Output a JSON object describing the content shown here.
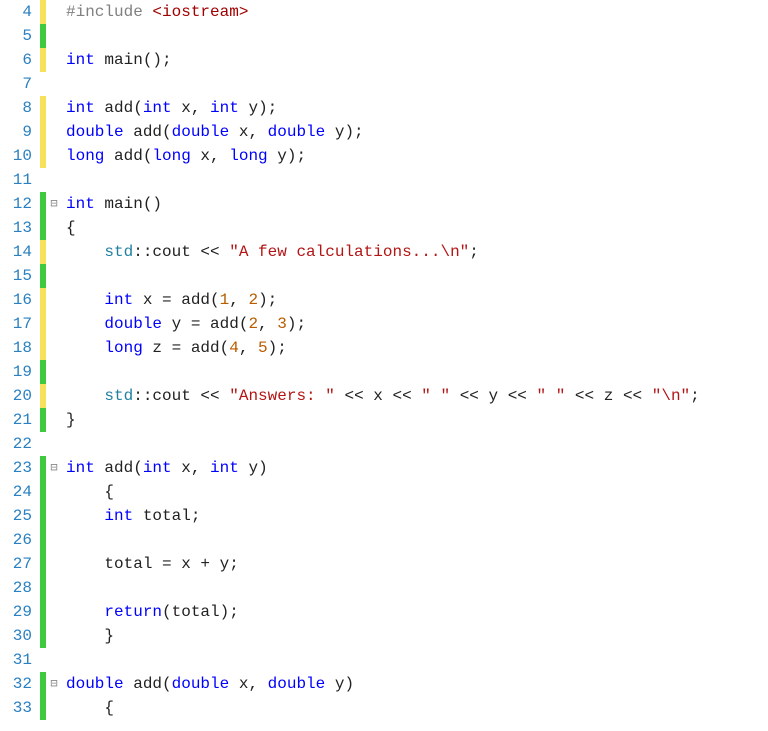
{
  "fold_glyph": "⊟",
  "lines": [
    {
      "n": 4,
      "mark": "m-y",
      "fold": "",
      "code": [
        {
          "c": "prep",
          "t": "#include "
        },
        {
          "c": "inc",
          "t": "<iostream>"
        }
      ]
    },
    {
      "n": 5,
      "mark": "m-g",
      "fold": "",
      "code": []
    },
    {
      "n": 6,
      "mark": "m-y",
      "fold": "",
      "code": [
        {
          "c": "kw",
          "t": "int"
        },
        {
          "c": "",
          "t": " main();"
        }
      ]
    },
    {
      "n": 7,
      "mark": "m-none",
      "fold": "",
      "code": []
    },
    {
      "n": 8,
      "mark": "m-y",
      "fold": "",
      "code": [
        {
          "c": "kw",
          "t": "int"
        },
        {
          "c": "",
          "t": " add("
        },
        {
          "c": "kw",
          "t": "int"
        },
        {
          "c": "",
          "t": " x, "
        },
        {
          "c": "kw",
          "t": "int"
        },
        {
          "c": "",
          "t": " y);"
        }
      ]
    },
    {
      "n": 9,
      "mark": "m-y",
      "fold": "",
      "code": [
        {
          "c": "kw",
          "t": "double"
        },
        {
          "c": "",
          "t": " add("
        },
        {
          "c": "kw",
          "t": "double"
        },
        {
          "c": "",
          "t": " x, "
        },
        {
          "c": "kw",
          "t": "double"
        },
        {
          "c": "",
          "t": " y);"
        }
      ]
    },
    {
      "n": 10,
      "mark": "m-y",
      "fold": "",
      "code": [
        {
          "c": "kw",
          "t": "long"
        },
        {
          "c": "",
          "t": " add("
        },
        {
          "c": "kw",
          "t": "long"
        },
        {
          "c": "",
          "t": " x, "
        },
        {
          "c": "kw",
          "t": "long"
        },
        {
          "c": "",
          "t": " y);"
        }
      ]
    },
    {
      "n": 11,
      "mark": "m-none",
      "fold": "",
      "code": []
    },
    {
      "n": 12,
      "mark": "m-g",
      "fold": "y",
      "code": [
        {
          "c": "kw",
          "t": "int"
        },
        {
          "c": "",
          "t": " main()"
        }
      ]
    },
    {
      "n": 13,
      "mark": "m-g",
      "fold": "",
      "code": [
        {
          "c": "",
          "t": "{"
        }
      ]
    },
    {
      "n": 14,
      "mark": "m-y",
      "fold": "",
      "code": [
        {
          "c": "",
          "t": "    "
        },
        {
          "c": "cls",
          "t": "std"
        },
        {
          "c": "",
          "t": "::cout << "
        },
        {
          "c": "str",
          "t": "\"A few calculations...\\n\""
        },
        {
          "c": "",
          "t": ";"
        }
      ]
    },
    {
      "n": 15,
      "mark": "m-g",
      "fold": "",
      "code": []
    },
    {
      "n": 16,
      "mark": "m-y",
      "fold": "",
      "code": [
        {
          "c": "",
          "t": "    "
        },
        {
          "c": "kw",
          "t": "int"
        },
        {
          "c": "",
          "t": " x = add("
        },
        {
          "c": "num",
          "t": "1"
        },
        {
          "c": "",
          "t": ", "
        },
        {
          "c": "num",
          "t": "2"
        },
        {
          "c": "",
          "t": ");"
        }
      ]
    },
    {
      "n": 17,
      "mark": "m-y",
      "fold": "",
      "code": [
        {
          "c": "",
          "t": "    "
        },
        {
          "c": "kw",
          "t": "double"
        },
        {
          "c": "",
          "t": " y = add("
        },
        {
          "c": "num",
          "t": "2"
        },
        {
          "c": "",
          "t": ", "
        },
        {
          "c": "num",
          "t": "3"
        },
        {
          "c": "",
          "t": ");"
        }
      ]
    },
    {
      "n": 18,
      "mark": "m-y",
      "fold": "",
      "code": [
        {
          "c": "",
          "t": "    "
        },
        {
          "c": "kw",
          "t": "long"
        },
        {
          "c": "",
          "t": " z = add("
        },
        {
          "c": "num",
          "t": "4"
        },
        {
          "c": "",
          "t": ", "
        },
        {
          "c": "num",
          "t": "5"
        },
        {
          "c": "",
          "t": ");"
        }
      ]
    },
    {
      "n": 19,
      "mark": "m-g",
      "fold": "",
      "code": []
    },
    {
      "n": 20,
      "mark": "m-y",
      "fold": "",
      "code": [
        {
          "c": "",
          "t": "    "
        },
        {
          "c": "cls",
          "t": "std"
        },
        {
          "c": "",
          "t": "::cout << "
        },
        {
          "c": "str",
          "t": "\"Answers: \""
        },
        {
          "c": "",
          "t": " << x << "
        },
        {
          "c": "str",
          "t": "\" \""
        },
        {
          "c": "",
          "t": " << y << "
        },
        {
          "c": "str",
          "t": "\" \""
        },
        {
          "c": "",
          "t": " << z << "
        },
        {
          "c": "str",
          "t": "\"\\n\""
        },
        {
          "c": "",
          "t": ";"
        }
      ]
    },
    {
      "n": 21,
      "mark": "m-g",
      "fold": "",
      "code": [
        {
          "c": "",
          "t": "}"
        }
      ]
    },
    {
      "n": 22,
      "mark": "m-none",
      "fold": "",
      "code": []
    },
    {
      "n": 23,
      "mark": "m-g",
      "fold": "y",
      "code": [
        {
          "c": "kw",
          "t": "int"
        },
        {
          "c": "",
          "t": " add("
        },
        {
          "c": "kw",
          "t": "int"
        },
        {
          "c": "",
          "t": " x, "
        },
        {
          "c": "kw",
          "t": "int"
        },
        {
          "c": "",
          "t": " y)"
        }
      ]
    },
    {
      "n": 24,
      "mark": "m-g",
      "fold": "",
      "code": [
        {
          "c": "",
          "t": "    {"
        }
      ]
    },
    {
      "n": 25,
      "mark": "m-g",
      "fold": "",
      "code": [
        {
          "c": "",
          "t": "    "
        },
        {
          "c": "kw",
          "t": "int"
        },
        {
          "c": "",
          "t": " total;"
        }
      ]
    },
    {
      "n": 26,
      "mark": "m-g",
      "fold": "",
      "code": []
    },
    {
      "n": 27,
      "mark": "m-g",
      "fold": "",
      "code": [
        {
          "c": "",
          "t": "    total = x + y;"
        }
      ]
    },
    {
      "n": 28,
      "mark": "m-g",
      "fold": "",
      "code": []
    },
    {
      "n": 29,
      "mark": "m-g",
      "fold": "",
      "code": [
        {
          "c": "",
          "t": "    "
        },
        {
          "c": "kw",
          "t": "return"
        },
        {
          "c": "",
          "t": "(total);"
        }
      ]
    },
    {
      "n": 30,
      "mark": "m-g",
      "fold": "",
      "code": [
        {
          "c": "",
          "t": "    }"
        }
      ]
    },
    {
      "n": 31,
      "mark": "m-none",
      "fold": "",
      "code": []
    },
    {
      "n": 32,
      "mark": "m-g",
      "fold": "y",
      "code": [
        {
          "c": "kw",
          "t": "double"
        },
        {
          "c": "",
          "t": " add("
        },
        {
          "c": "kw",
          "t": "double"
        },
        {
          "c": "",
          "t": " x, "
        },
        {
          "c": "kw",
          "t": "double"
        },
        {
          "c": "",
          "t": " y)"
        }
      ]
    },
    {
      "n": 33,
      "mark": "m-g",
      "fold": "",
      "code": [
        {
          "c": "",
          "t": "    {"
        }
      ]
    }
  ]
}
